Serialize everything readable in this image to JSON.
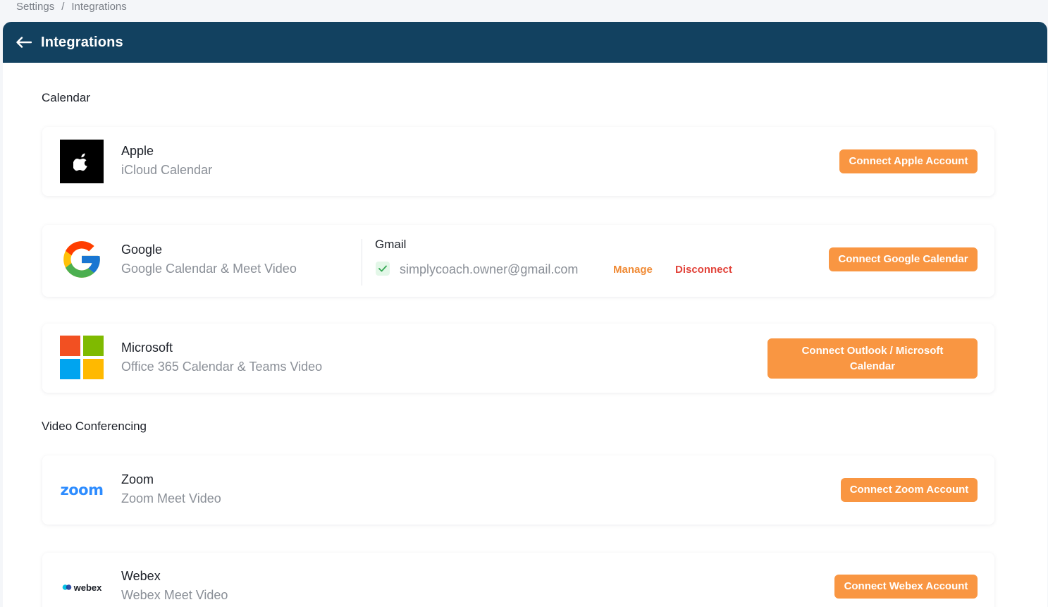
{
  "breadcrumb": {
    "parent": "Settings",
    "separator": "/",
    "current": "Integrations"
  },
  "header": {
    "title": "Integrations",
    "back_icon": "arrow-left-icon"
  },
  "sections": {
    "calendar": {
      "title": "Calendar"
    },
    "video": {
      "title": "Video Conferencing"
    }
  },
  "apple": {
    "name": "Apple",
    "sub": "iCloud Calendar",
    "button": "Connect Apple Account"
  },
  "google": {
    "name": "Google",
    "sub": "Google Calendar & Meet Video",
    "button": "Connect Google Calendar",
    "account_label": "Gmail",
    "email": "simplycoach.owner@gmail.com",
    "manage": "Manage",
    "disconnect": "Disconnect"
  },
  "microsoft": {
    "name": "Microsoft",
    "sub": "Office 365 Calendar & Teams Video",
    "button": "Connect Outlook / Microsoft Calendar"
  },
  "zoom": {
    "name": "Zoom",
    "sub": "Zoom Meet Video",
    "button": "Connect Zoom Account",
    "logo_text": "zoom"
  },
  "webex": {
    "name": "Webex",
    "sub": "Webex Meet Video",
    "button": "Connect Webex Account",
    "logo_text": "webex"
  },
  "colors": {
    "header": "#124160",
    "accent": "#f99642",
    "danger": "#e2443b",
    "manage": "#f08b36"
  }
}
